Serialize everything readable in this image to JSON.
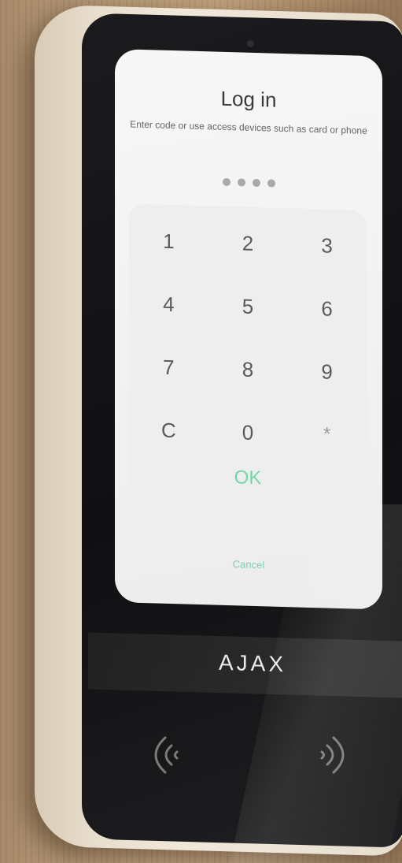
{
  "screen": {
    "title": "Log in",
    "subtitle": "Enter code or use access devices such as card or phone",
    "pin_dots_count": 4,
    "keypad": {
      "keys": [
        "1",
        "2",
        "3",
        "4",
        "5",
        "6",
        "7",
        "8",
        "9",
        "C",
        "0",
        "*"
      ]
    },
    "ok_label": "OK",
    "cancel_label": "Cancel"
  },
  "device": {
    "brand": "AJAX",
    "nfc_left_icon": "contactless-left-icon",
    "nfc_right_icon": "contactless-right-icon"
  },
  "colors": {
    "accent": "#73d7a9",
    "screen_bg": "#f3f3f3",
    "panel": "#121214",
    "shell": "#e9dfcf"
  }
}
